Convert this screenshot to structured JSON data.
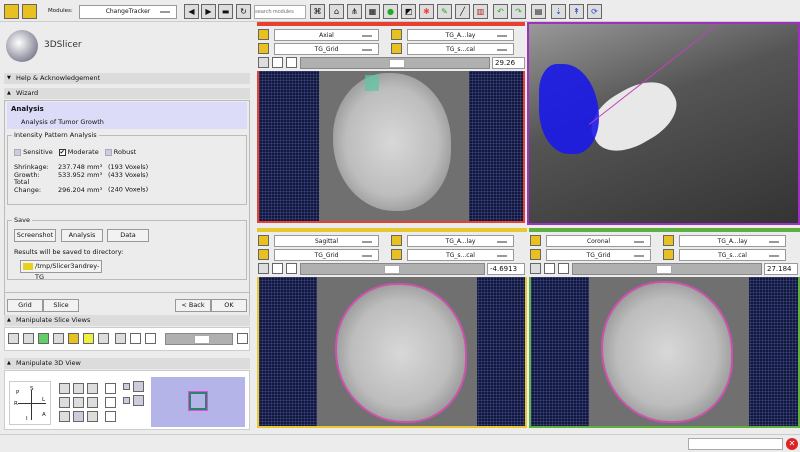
{
  "toolbar": {
    "modules_label": "Modules:",
    "module_value": "ChangeTracker",
    "search_placeholder": "search modules"
  },
  "logo": {
    "text": "3DSlicer"
  },
  "sections": {
    "help": "Help & Acknowledgement",
    "wizard": "Wizard",
    "manip_slice": "Manipulate Slice Views",
    "manip_3d": "Manipulate 3D View"
  },
  "wizard": {
    "step_title": "Analysis",
    "step_subtitle": "Analysis of Tumor Growth",
    "intensity_group": "Intensity Pattern Analysis",
    "checks": [
      {
        "label": "Sensitive",
        "checked": false
      },
      {
        "label": "Moderate",
        "checked": true
      },
      {
        "label": "Robust",
        "checked": false
      }
    ],
    "results": [
      {
        "label": "Shrinkage:",
        "volume": "237.748 mm³",
        "voxels": "(193 Voxels)"
      },
      {
        "label": "Growth:",
        "volume": "533.952 mm³",
        "voxels": "(433 Voxels)"
      },
      {
        "label": "Total Change:",
        "volume": "296.204 mm³",
        "voxels": "(240 Voxels)"
      }
    ],
    "save_group": "Save",
    "save_buttons": [
      "Screenshot",
      "Analysis",
      "Data"
    ],
    "save_note": "Results will be saved to directory:",
    "directory": "/tmp/Slicer3andrey-TG",
    "nav": {
      "grid": "Grid",
      "slice": "Slice",
      "back": "< Back",
      "ok": "OK"
    }
  },
  "orientation": {
    "S": "S",
    "P": "P",
    "R": "R",
    "L": "L",
    "I": "I",
    "A": "A"
  },
  "views": {
    "axial": {
      "orientation": "Axial",
      "fg": "TG_A...lay",
      "bg": "TG_Grid",
      "lbl": "TG_s...cal",
      "offset": "29.26",
      "color": "#e84030"
    },
    "sagittal": {
      "orientation": "Sagittal",
      "fg": "TG_A...lay",
      "bg": "TG_Grid",
      "lbl": "TG_s...cal",
      "offset": "-4.6913",
      "color": "#e8c830"
    },
    "coronal": {
      "orientation": "Coronal",
      "fg": "TG_A...lay",
      "bg": "TG_Grid",
      "lbl": "TG_s...cal",
      "offset": "27.184",
      "color": "#60b040"
    }
  }
}
